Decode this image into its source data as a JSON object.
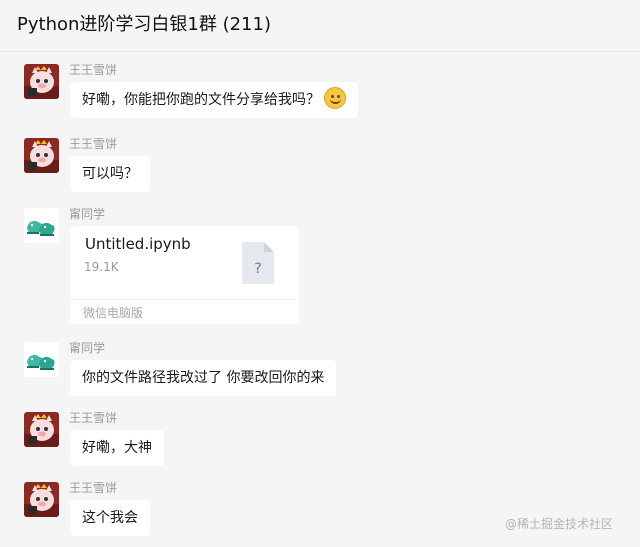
{
  "window": {
    "title": "Python进阶学习白银1群 (211)"
  },
  "messages": [
    {
      "sender": "王王雪饼",
      "avatar": "cartoon-pig-avatar",
      "text": "好嘞，你能把你跑的文件分享给我吗？",
      "emoji": "smile-emoji"
    },
    {
      "sender": "王王雪饼",
      "avatar": "cartoon-pig-avatar",
      "text": "可以吗？"
    },
    {
      "sender": "甯同学",
      "avatar": "green-shoes-avatar",
      "file": {
        "name": "Untitled.ipynb",
        "size": "19.1K",
        "icon": "unknown-file-icon",
        "icon_glyph": "?",
        "source": "微信电脑版"
      }
    },
    {
      "sender": "甯同学",
      "avatar": "green-shoes-avatar",
      "text": "你的文件路径我改过了 你要改回你的来"
    },
    {
      "sender": "王王雪饼",
      "avatar": "cartoon-pig-avatar",
      "text": "好嘞，大神"
    },
    {
      "sender": "王王雪饼",
      "avatar": "cartoon-pig-avatar",
      "text": "这个我会"
    }
  ],
  "watermark": "@稀土掘金技术社区",
  "colors": {
    "background": "#f5f5f5",
    "bubble": "#ffffff",
    "sender_text": "#9a9a9a"
  }
}
